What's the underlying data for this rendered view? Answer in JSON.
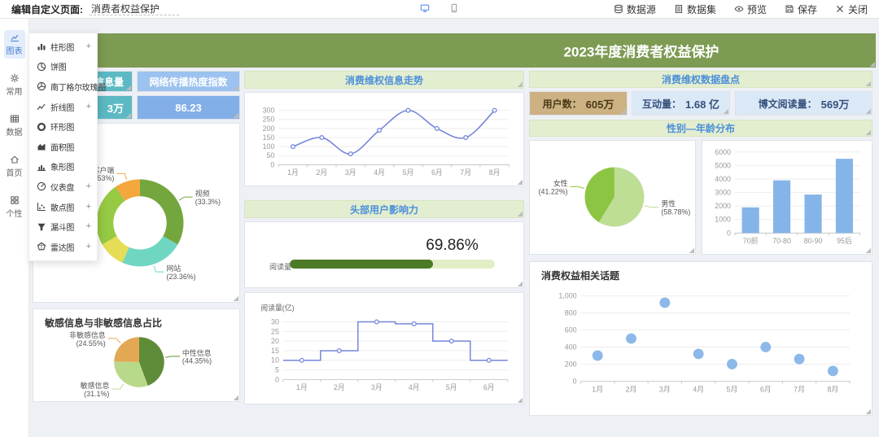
{
  "toolbar": {
    "edit_label": "编辑自定义页面:",
    "page_title_value": "消费者权益保护",
    "device_buttons": [
      {
        "name": "desktop-preview-button",
        "icon": "desktop-icon",
        "active": true
      },
      {
        "name": "mobile-preview-button",
        "icon": "mobile-icon",
        "active": false
      }
    ],
    "actions": [
      {
        "name": "datasource-button",
        "label": "数据源",
        "icon": "database-icon"
      },
      {
        "name": "dataset-button",
        "label": "数据集",
        "icon": "dataset-icon"
      },
      {
        "name": "preview-button",
        "label": "预览",
        "icon": "eye-icon"
      },
      {
        "name": "save-button",
        "label": "保存",
        "icon": "save-icon"
      },
      {
        "name": "close-button",
        "label": "关闭",
        "icon": "close-icon"
      }
    ]
  },
  "sidebar": {
    "items": [
      {
        "name": "sidebar-item-charts",
        "label": "图表",
        "icon": "chart-icon",
        "active": true
      },
      {
        "name": "sidebar-item-common",
        "label": "常用",
        "icon": "gear-icon",
        "active": false
      },
      {
        "name": "sidebar-item-data",
        "label": "数据",
        "icon": "table-icon",
        "active": false
      },
      {
        "name": "sidebar-item-home",
        "label": "首页",
        "icon": "home-icon",
        "active": false
      },
      {
        "name": "sidebar-item-personal",
        "label": "个性",
        "icon": "grid-icon",
        "active": false
      }
    ]
  },
  "chart_menu": {
    "expand_glyph": "+",
    "items": [
      {
        "name": "menu-item-bar-chart",
        "label": "柱形图",
        "icon": "bar-chart-icon",
        "expandable": true
      },
      {
        "name": "menu-item-pie-chart",
        "label": "饼图",
        "icon": "pie-chart-icon",
        "expandable": false
      },
      {
        "name": "menu-item-rose-chart",
        "label": "南丁格尔玫瑰图",
        "icon": "rose-chart-icon",
        "expandable": false
      },
      {
        "name": "menu-item-line-chart",
        "label": "折线图",
        "icon": "line-chart-icon",
        "expandable": true
      },
      {
        "name": "menu-item-ring-chart",
        "label": "环形图",
        "icon": "ring-chart-icon",
        "expandable": false
      },
      {
        "name": "menu-item-area-chart",
        "label": "面积图",
        "icon": "area-chart-icon",
        "expandable": false
      },
      {
        "name": "menu-item-pictogram-chart",
        "label": "象形图",
        "icon": "pictogram-chart-icon",
        "expandable": false
      },
      {
        "name": "menu-item-gauge-chart",
        "label": "仪表盘",
        "icon": "gauge-chart-icon",
        "expandable": true
      },
      {
        "name": "menu-item-scatter-chart",
        "label": "散点图",
        "icon": "scatter-chart-icon",
        "expandable": true
      },
      {
        "name": "menu-item-funnel-chart",
        "label": "漏斗图",
        "icon": "funnel-chart-icon",
        "expandable": true
      },
      {
        "name": "menu-item-radar-chart",
        "label": "雷达图",
        "icon": "radar-chart-icon",
        "expandable": true
      }
    ]
  },
  "dashboard": {
    "banner_title": "2023年度消费者权益保护",
    "info_card": {
      "label": "信息量",
      "value": "3万"
    },
    "heat_card": {
      "label": "网络传播热度指数",
      "value": "86.23"
    },
    "sections": {
      "summary_header": "消费维权数据盘点",
      "gender_age_header": "性别—年龄分布"
    },
    "summary_cards": [
      {
        "label": "用户数：",
        "value": "605万"
      },
      {
        "label": "互动量：",
        "value": "1.68 亿"
      },
      {
        "label": "博文阅读量：",
        "value": "569万"
      }
    ]
  },
  "theme": {
    "banner_green": "#7d9b53",
    "section_header_bg": "#e3edd0",
    "section_header_text": "#4a90d9",
    "teal_card": "#5cb9c3",
    "blue_label_card": "#9cc2ef",
    "blue_value_card": "#83afe9",
    "tan_card": "#ccb183",
    "light_blue_card": "#dbe9f7",
    "sidebar_active": "#4a7fd4"
  },
  "chart_data": [
    {
      "id": "trend_line",
      "type": "line",
      "title": "消费维权信息走势",
      "x": [
        "1月",
        "2月",
        "3月",
        "4月",
        "5月",
        "6月",
        "7月",
        "8月"
      ],
      "values": [
        100,
        150,
        60,
        190,
        300,
        200,
        150,
        300
      ],
      "ylim": [
        0,
        300
      ],
      "ytick_step": 50,
      "ytick_format": "plain",
      "grid": true,
      "smooth": true,
      "color": "#7585da"
    },
    {
      "id": "media_donut",
      "type": "donut",
      "slices": [
        {
          "label": "视频",
          "pct_label": "(33.3%)",
          "pct": 33.3,
          "color": "#74a63e"
        },
        {
          "label": "网站",
          "pct_label": "(23.36%)",
          "pct": 23.36,
          "color": "#6fd6c2"
        },
        {
          "label": "",
          "pct_label": "",
          "pct": 10.1,
          "color": "#e5dd55"
        },
        {
          "label": "",
          "pct_label": "",
          "pct": 23.71,
          "color": "#96ca43"
        },
        {
          "label": "客户端",
          "pct_label": "(9.53%)",
          "pct": 9.53,
          "color": "#f3a73c"
        }
      ]
    },
    {
      "id": "influence_progress",
      "type": "progress",
      "title": "头部用户影响力",
      "percent": 69.86,
      "percent_label": "69.86%",
      "bar_label": "阅读量",
      "fill_color": "#4c7a26",
      "track_color": "#e3eec6"
    },
    {
      "id": "reading_step",
      "type": "step",
      "ylabel": "阅读量(亿)",
      "x": [
        "1月",
        "2月",
        "3月",
        "4月",
        "5月",
        "6月"
      ],
      "values": [
        10,
        15,
        30,
        29,
        20,
        10
      ],
      "ylim": [
        0,
        30
      ],
      "ytick_step": 5,
      "ytick_format": "plain",
      "grid": true,
      "color": "#7585da"
    },
    {
      "id": "sentiment_pie",
      "type": "pie",
      "title": "敏感信息与非敏感信息占比",
      "slices": [
        {
          "label": "中性信息",
          "pct_label": "(44.35%)",
          "pct": 44.35,
          "color": "#5e8c38"
        },
        {
          "label": "敏感信息",
          "pct_label": "(31.1%)",
          "pct": 31.1,
          "color": "#b9d98a"
        },
        {
          "label": "非敏感信息",
          "pct_label": "(24.55%)",
          "pct": 24.55,
          "color": "#e2a854"
        }
      ]
    },
    {
      "id": "gender_pie",
      "type": "pie",
      "slices": [
        {
          "label": "男性",
          "pct_label": "(58.78%)",
          "pct": 58.78,
          "color": "#bede96"
        },
        {
          "label": "女性",
          "pct_label": "(41.22%)",
          "pct": 41.22,
          "color": "#8cc544"
        }
      ]
    },
    {
      "id": "age_bar",
      "type": "bar",
      "categories": [
        "70前",
        "70-80",
        "80-90",
        "95后"
      ],
      "values": [
        1900,
        3900,
        2850,
        5500
      ],
      "ylim": [
        0,
        6000
      ],
      "ytick_step": 1000,
      "ytick_format": "plain",
      "grid": true,
      "color": "#85b5e8"
    },
    {
      "id": "topics_scatter",
      "type": "scatter",
      "title": "消费权益相关话题",
      "x": [
        "1月",
        "2月",
        "3月",
        "4月",
        "5月",
        "6月",
        "7月",
        "8月"
      ],
      "values": [
        300,
        500,
        920,
        320,
        200,
        400,
        260,
        120
      ],
      "ylim": [
        0,
        1000
      ],
      "ytick_step": 200,
      "ytick_format": "comma",
      "grid": true,
      "color": "#8cb9e9"
    }
  ]
}
